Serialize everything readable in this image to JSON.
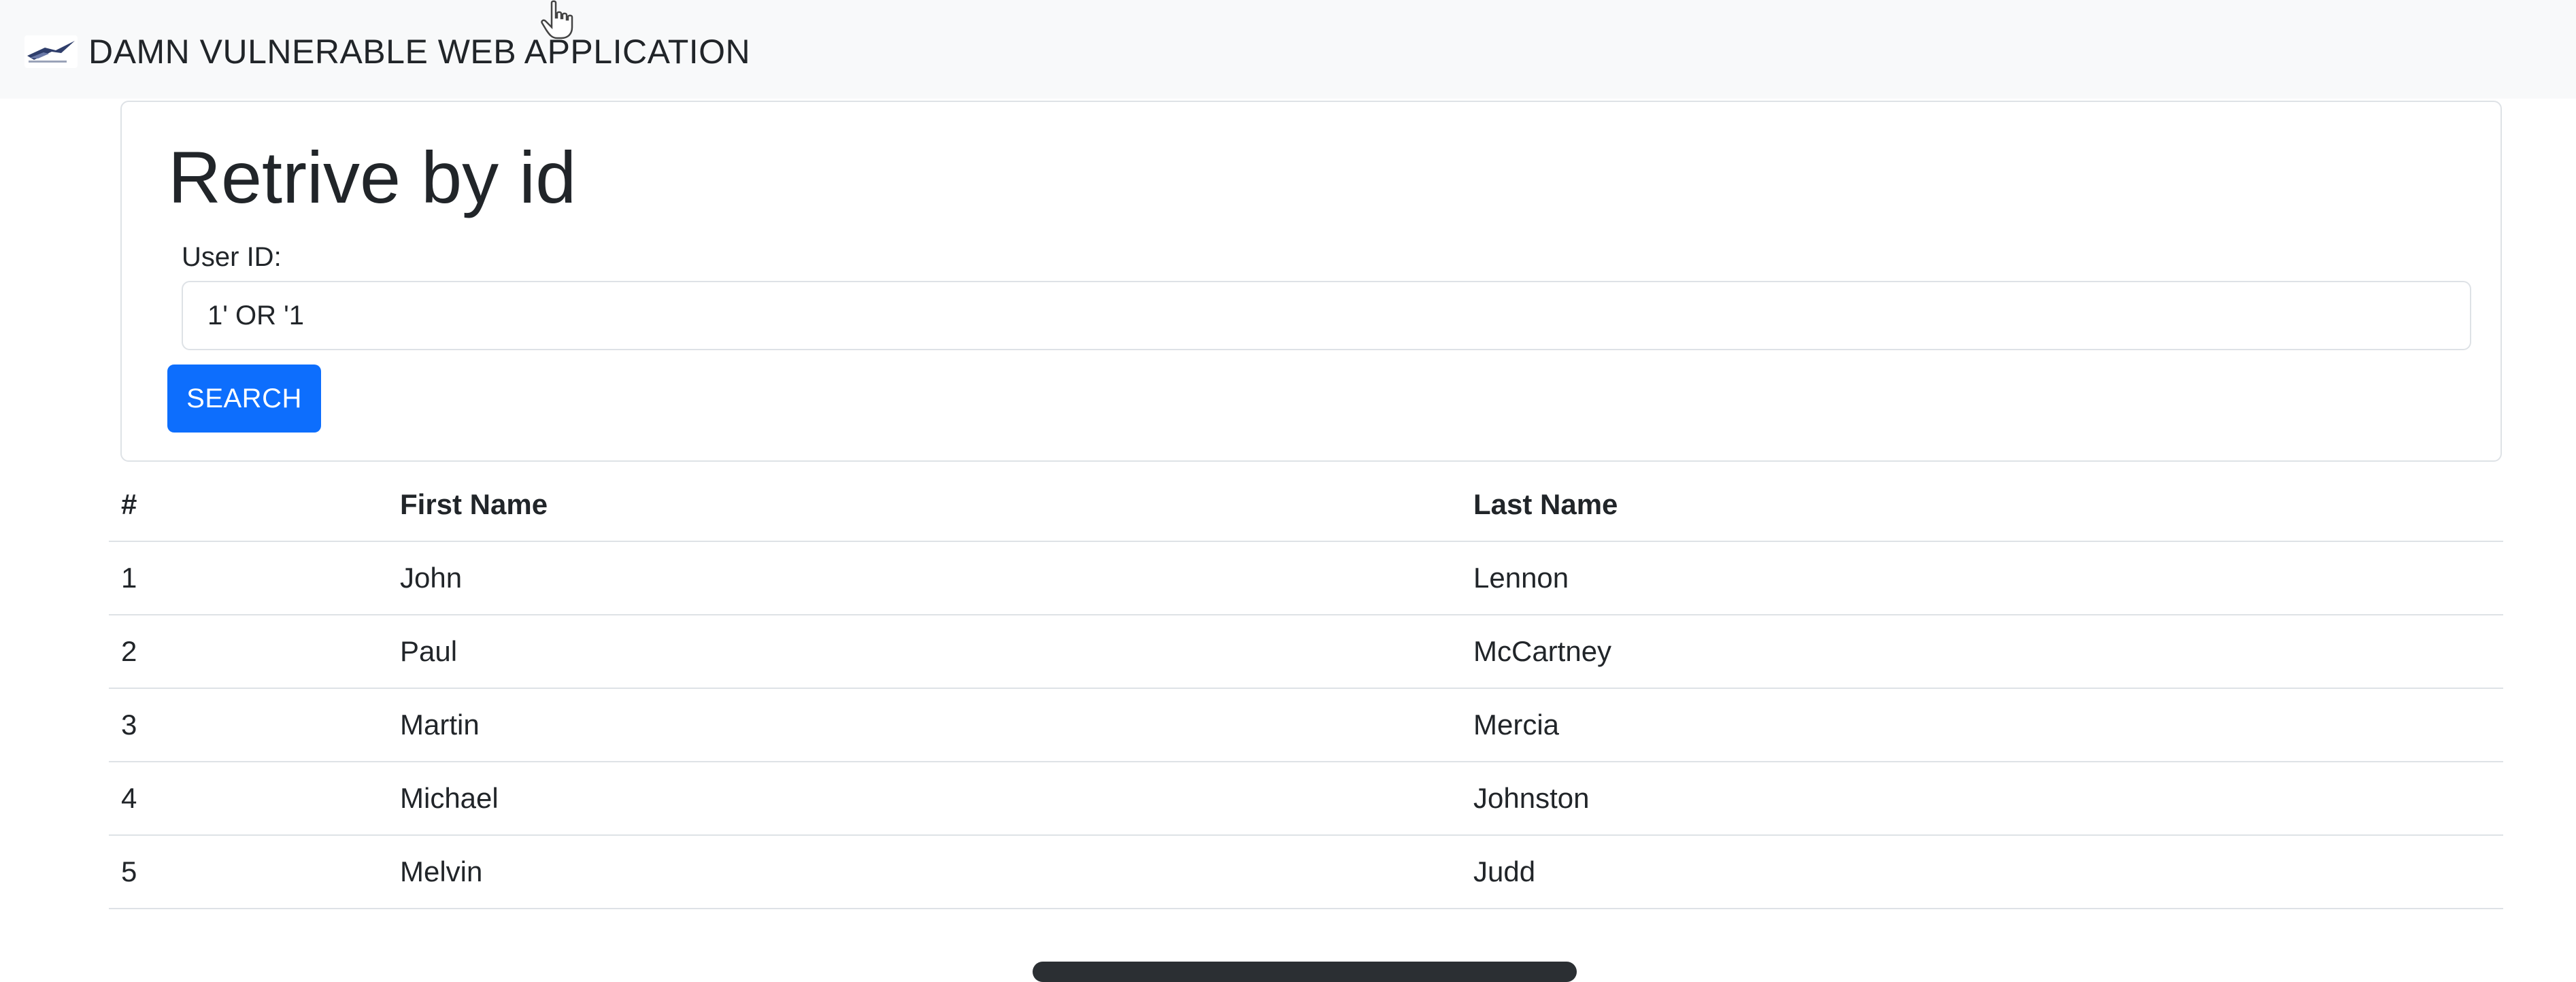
{
  "navbar": {
    "brand_title": "DAMN VULNERABLE WEB APPLICATION",
    "logo_icon": "dvwa-logo-icon"
  },
  "form": {
    "heading": "Retrive by id",
    "user_id_label": "User ID:",
    "user_id_value": "1' OR '1",
    "search_button": "SEARCH"
  },
  "table": {
    "headers": [
      "#",
      "First Name",
      "Last Name"
    ],
    "rows": [
      {
        "id": "1",
        "first": "John",
        "last": "Lennon"
      },
      {
        "id": "2",
        "first": "Paul",
        "last": "McCartney"
      },
      {
        "id": "3",
        "first": "Martin",
        "last": "Mercia"
      },
      {
        "id": "4",
        "first": "Michael",
        "last": "Johnston"
      },
      {
        "id": "5",
        "first": "Melvin",
        "last": "Judd"
      }
    ]
  },
  "colors": {
    "primary": "#0d6efd",
    "navbar_bg": "#f8f9fa",
    "border": "#dee2e6",
    "text": "#212529"
  },
  "icons": [
    "dvwa-logo-icon",
    "hand-pointer-cursor-icon"
  ]
}
